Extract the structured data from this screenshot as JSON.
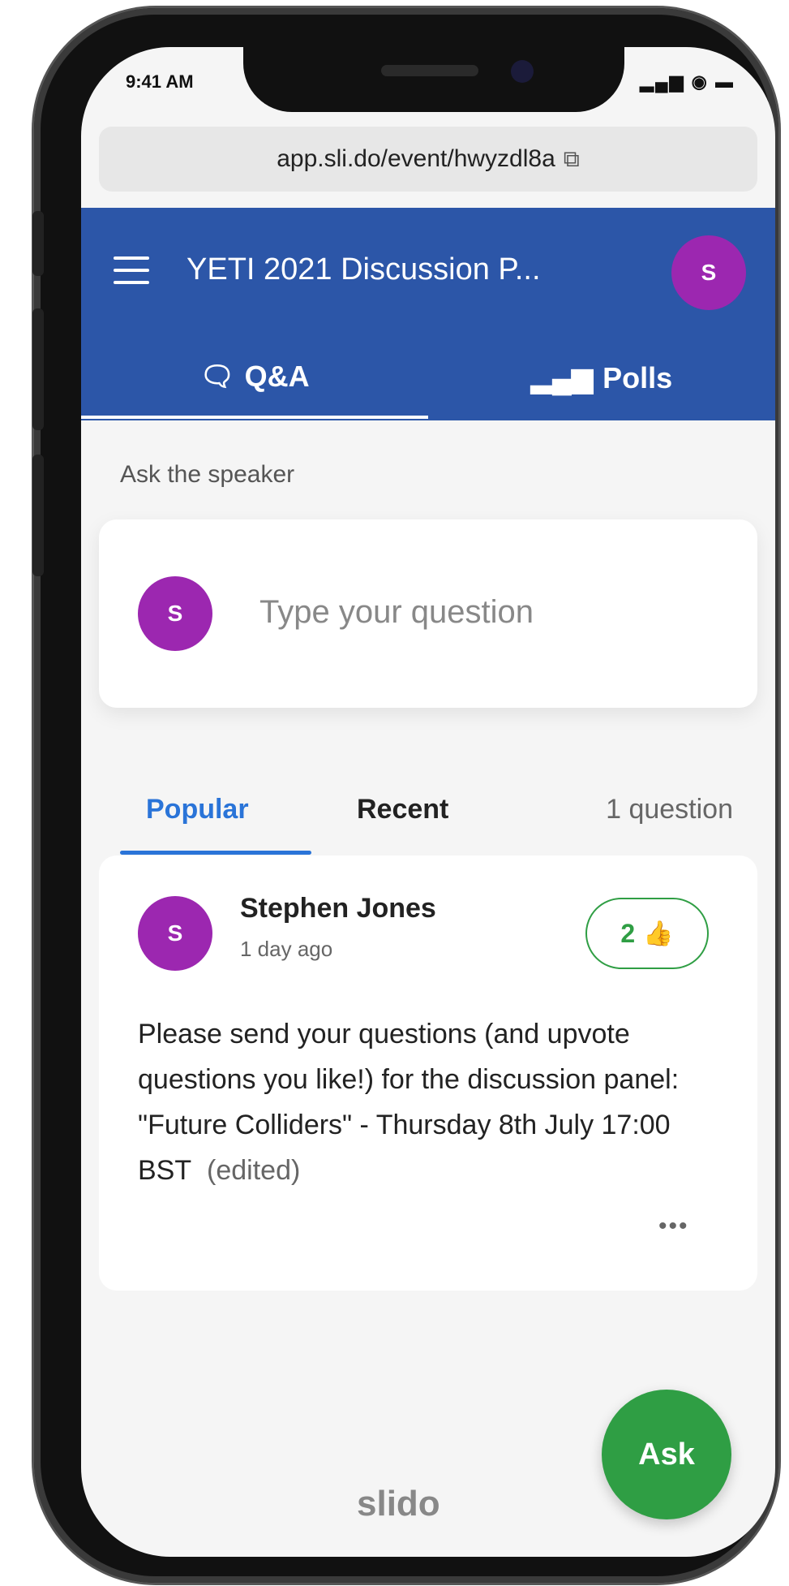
{
  "status_bar": {
    "time": "9:41 AM",
    "icons_text": "▂▄▆ ◉ ▬"
  },
  "browser": {
    "url": "app.sli.do/event/hwyzdl8a",
    "copy_icon": "copy-icon"
  },
  "app_bar": {
    "title": "YETI 2021 Discussion P...",
    "avatar_initial": "S",
    "tabs": [
      {
        "label": "Q&A",
        "icon": "chat-icon",
        "active": true
      },
      {
        "label": "Polls",
        "icon": "bar-chart-icon",
        "active": false
      }
    ]
  },
  "ask": {
    "label": "Ask the speaker",
    "avatar_initial": "S",
    "placeholder": "Type your question"
  },
  "sort": {
    "tabs": [
      "Popular",
      "Recent"
    ],
    "active": "Popular",
    "count": "1 question"
  },
  "question": {
    "avatar_initial": "S",
    "author": "Stephen Jones",
    "time_ago": "1 day ago",
    "upvotes": "2",
    "text": "Please send your questions (and upvote questions you like!) for the discussion panel: \"Future Colliders\" - Thursday 8th July 17:00 BST",
    "edited_label": "(edited)",
    "more_label": "•••"
  },
  "footer": {
    "brand": "slido",
    "ask_button": "Ask"
  },
  "colors": {
    "brand_blue": "#2c56a8",
    "accent_blue": "#2a74d8",
    "avatar_purple": "#9c27b0",
    "green": "#2f9e44"
  }
}
